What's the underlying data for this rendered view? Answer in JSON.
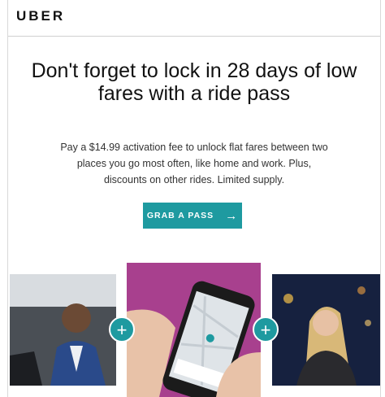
{
  "header": {
    "logo_text": "UBER"
  },
  "main": {
    "headline": "Don't forget to lock in 28 days of low fares with a ride pass",
    "body": "Pay a $14.99 activation fee to unlock flat fares between two places you go most often, like home and work. Plus, discounts on other rides. Limited supply.",
    "cta_label": "GRAB A PASS"
  },
  "colors": {
    "accent": "#1e9aa0",
    "text": "#222222"
  },
  "icons": {
    "cta_arrow": "arrow-right-icon",
    "connector": "plus-icon"
  },
  "photos": [
    {
      "name": "rider-in-car-photo"
    },
    {
      "name": "phone-app-photo"
    },
    {
      "name": "smiling-passenger-photo"
    }
  ]
}
